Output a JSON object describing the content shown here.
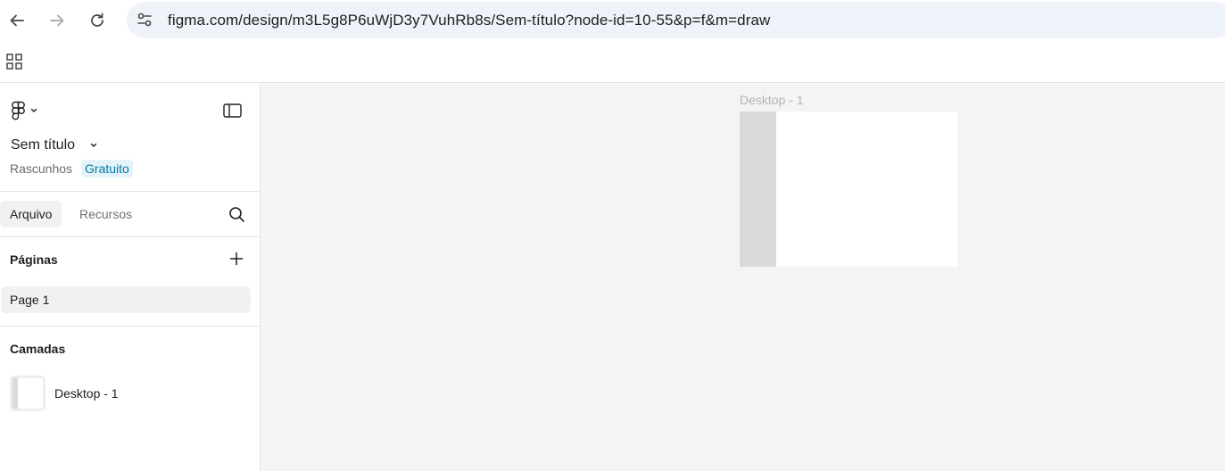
{
  "browser": {
    "url": "figma.com/design/m3L5g8P6uWjD3y7VuhRb8s/Sem-título?node-id=10-55&p=f&m=draw"
  },
  "file": {
    "name": "Sem título",
    "location": "Rascunhos",
    "plan_badge": "Gratuito"
  },
  "tabs": {
    "file": "Arquivo",
    "assets": "Recursos"
  },
  "pages": {
    "title": "Páginas",
    "items": [
      "Page 1"
    ]
  },
  "layers": {
    "title": "Camadas",
    "items": [
      "Desktop - 1"
    ]
  },
  "canvas": {
    "frame_label": "Desktop - 1",
    "background": "#f4f4f4",
    "frame_fill": "#ffffff",
    "rect_fill": "#d9d9d9"
  },
  "colors": {
    "badge_bg": "#e5f4fa",
    "badge_text": "#007ba6",
    "omnibox_bg": "#eef2f9"
  },
  "icons": [
    "back-arrow-icon",
    "forward-arrow-icon",
    "reload-icon",
    "site-settings-icon",
    "apps-grid-icon",
    "figma-logo-icon",
    "chevron-down-icon",
    "sidebar-toggle-icon",
    "search-icon",
    "plus-icon",
    "frame-thumbnail-icon"
  ]
}
